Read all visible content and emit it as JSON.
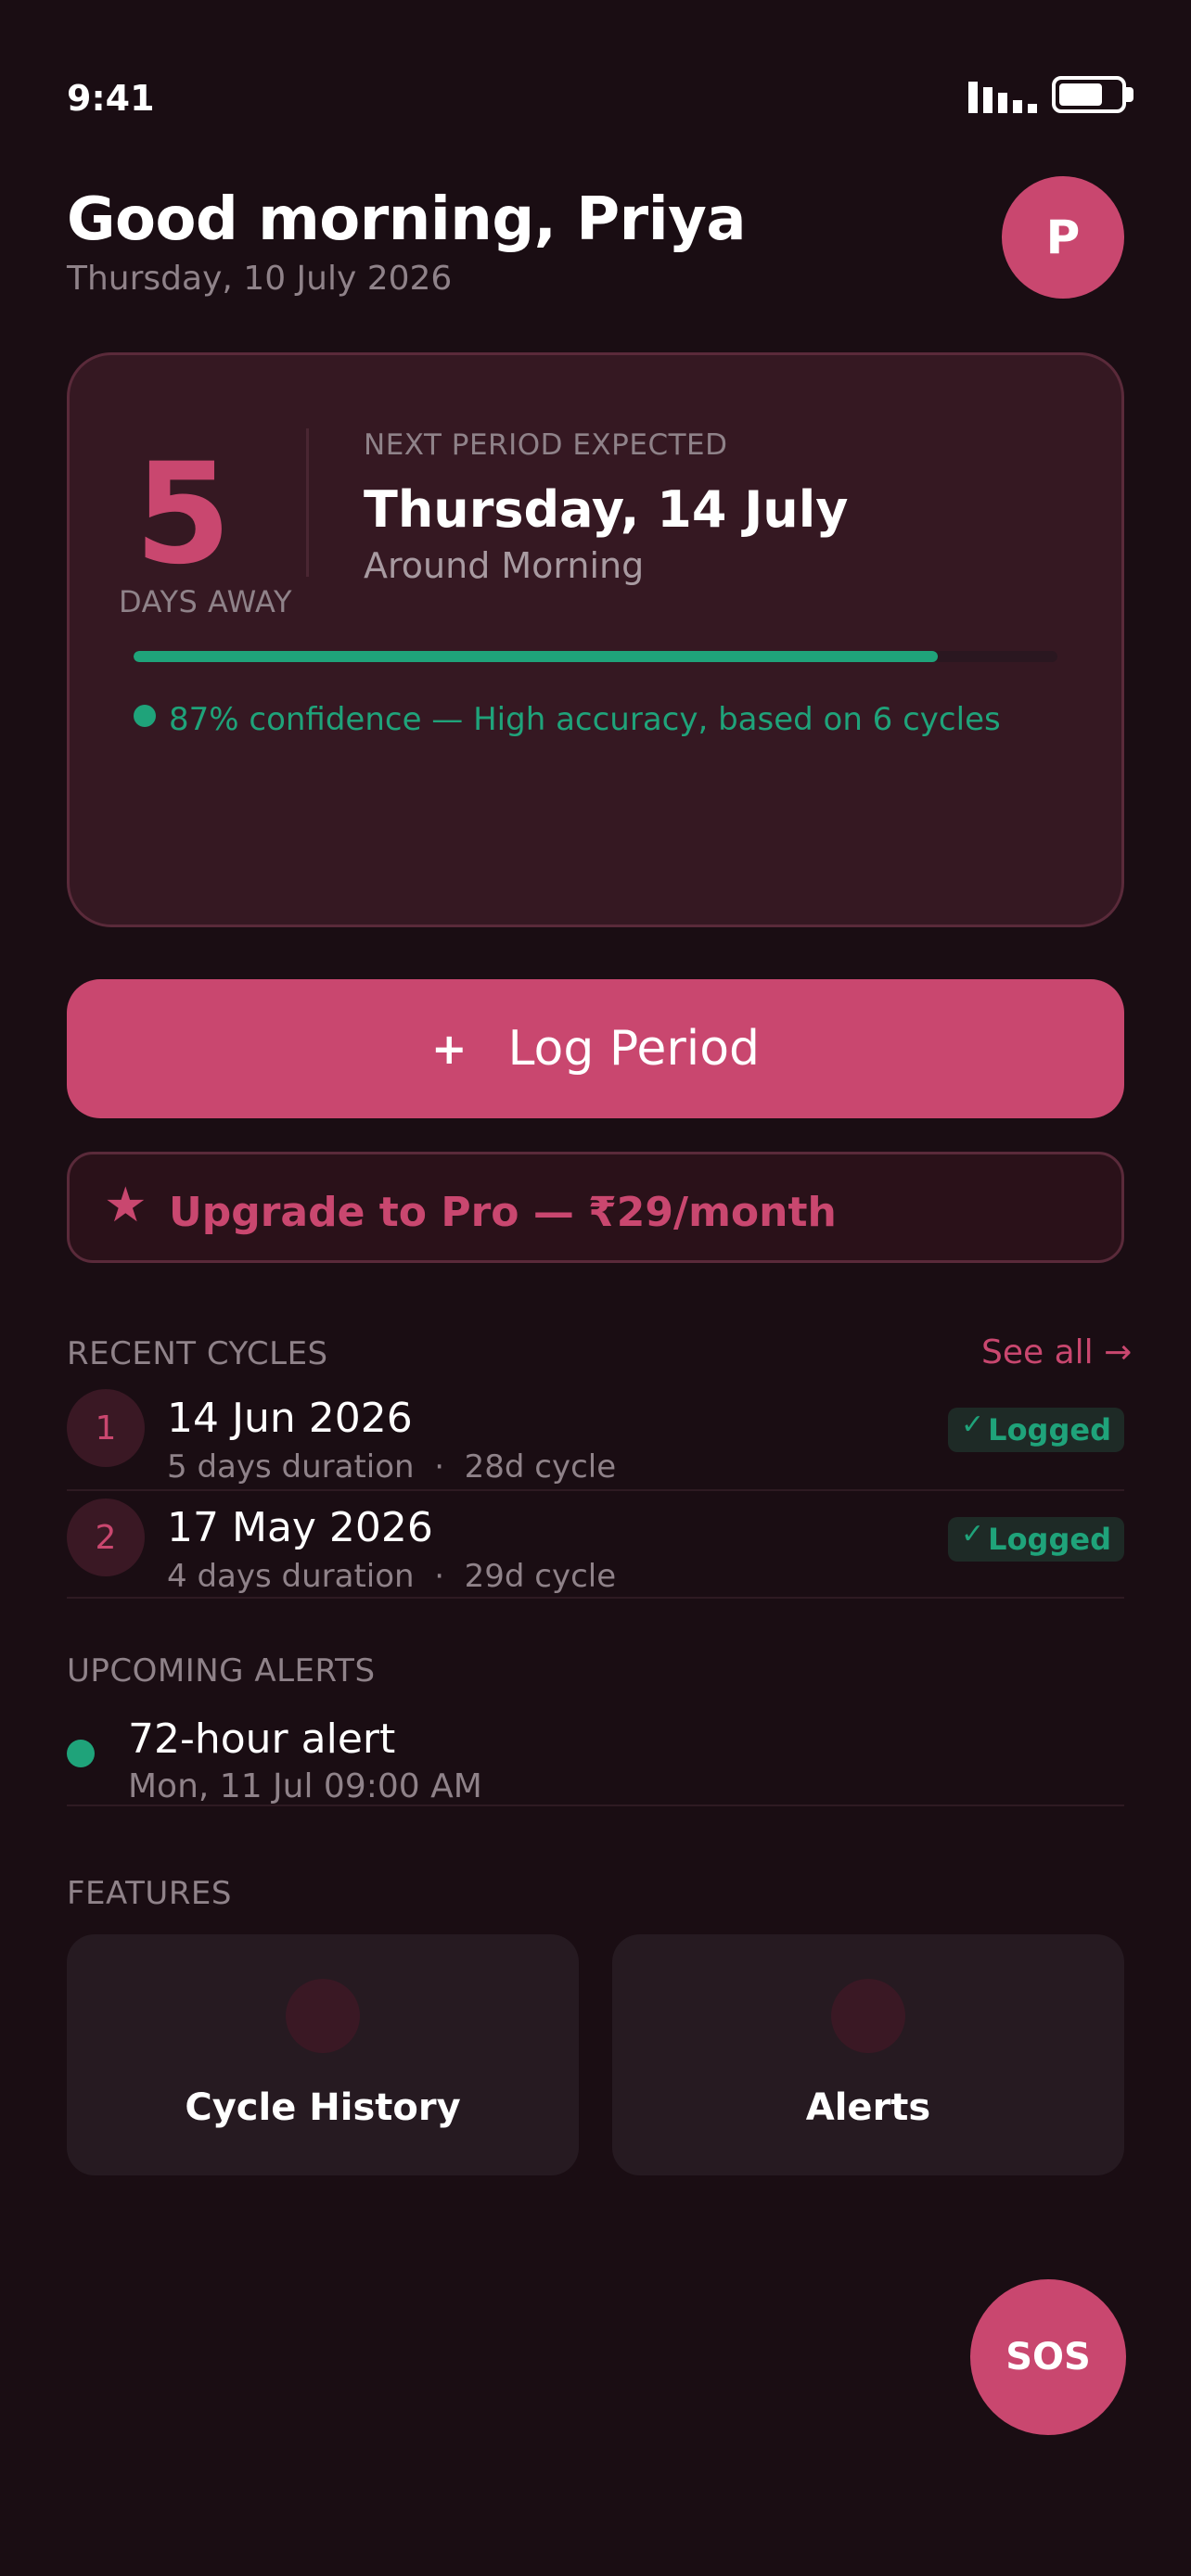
{
  "status": {
    "time": "9:41"
  },
  "header": {
    "greeting": "Good morning, Priya",
    "date": "Thursday, 10 July 2026",
    "avatar_initial": "P"
  },
  "prediction": {
    "days_number": "5",
    "days_label": "DAYS AWAY",
    "next_label": "NEXT PERIOD EXPECTED",
    "next_date": "Thursday, 14 July",
    "next_time": "Around Morning",
    "confidence": 0.87,
    "confidence_text": "87% confidence — High accuracy, based on 6 cycles"
  },
  "actions": {
    "log_plus": "+",
    "log_label": "Log Period",
    "upgrade_star": "★",
    "upgrade_label": "Upgrade to Pro — ₹29/month"
  },
  "recent": {
    "title": "RECENT CYCLES",
    "see_all": "See all →",
    "items": [
      {
        "index": "1",
        "date": "14 Jun 2026",
        "duration": "5 days duration",
        "cycle": "28d cycle",
        "status": "Logged"
      },
      {
        "index": "2",
        "date": "17 May 2026",
        "duration": "4 days duration",
        "cycle": "29d cycle",
        "status": "Logged"
      }
    ]
  },
  "alerts": {
    "title": "UPCOMING ALERTS",
    "items": [
      {
        "title": "72-hour alert",
        "time": "Mon, 11 Jul  09:00 AM"
      }
    ]
  },
  "features": {
    "title": "FEATURES",
    "items": [
      {
        "label": "Cycle History"
      },
      {
        "label": "Alerts"
      }
    ]
  },
  "sos": {
    "label": "SOS"
  },
  "colors": {
    "accent": "#c9476f",
    "success": "#1fa37a",
    "background": "#1a0d13"
  },
  "icons": {
    "signal": "signal-icon",
    "battery": "battery-icon",
    "star": "star-icon",
    "check": "check-icon"
  }
}
